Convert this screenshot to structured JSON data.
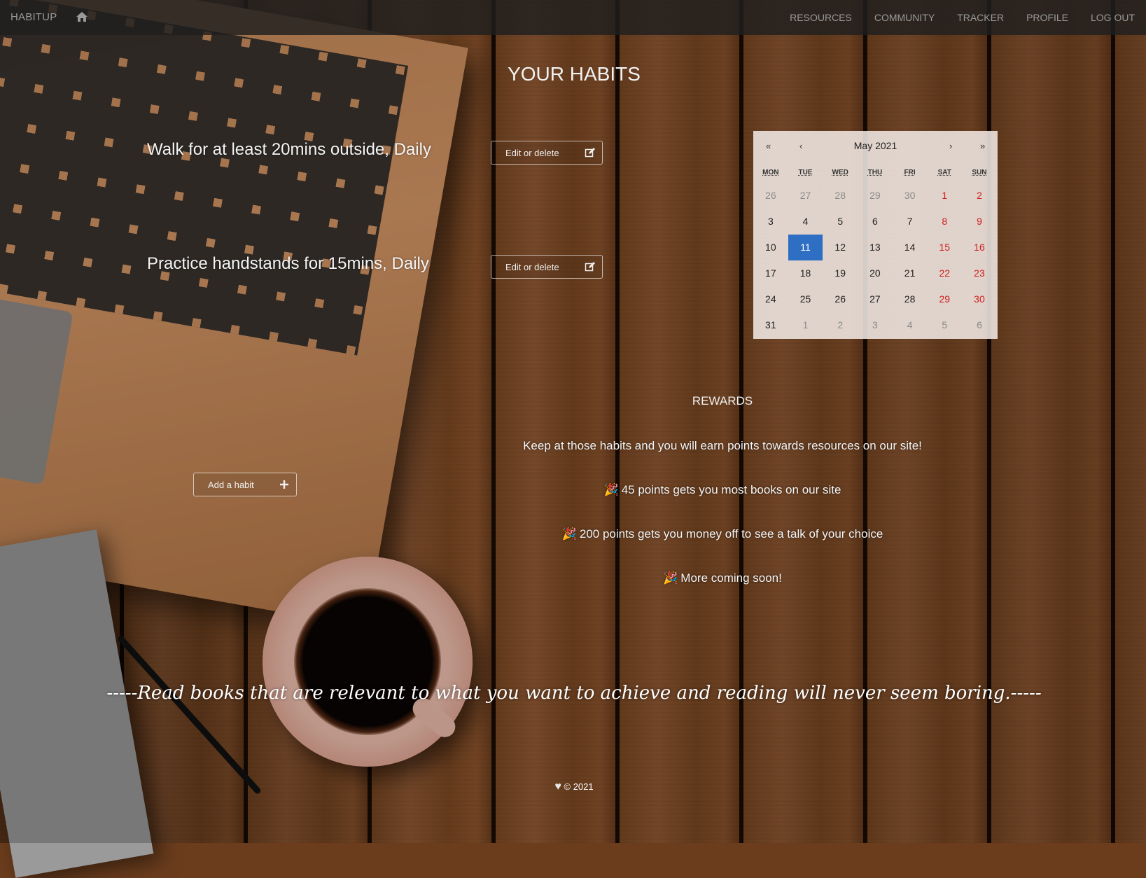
{
  "nav": {
    "brand": "HABITUP",
    "links": [
      "RESOURCES",
      "COMMUNITY",
      "TRACKER",
      "PROFILE",
      "LOG OUT"
    ]
  },
  "page": {
    "title": "YOUR HABITS"
  },
  "habits": [
    {
      "text": "Walk for at least 20mins outside, Daily",
      "button": "Edit or delete"
    },
    {
      "text": "Practice handstands for 15mins, Daily",
      "button": "Edit or delete"
    }
  ],
  "add_habit": {
    "label": "Add a habit"
  },
  "calendar": {
    "month": "May 2021",
    "nav": {
      "prev_year": "«",
      "prev_month": "‹",
      "next_month": "›",
      "next_year": "»"
    },
    "weekdays": [
      "MON",
      "TUE",
      "WED",
      "THU",
      "FRI",
      "SAT",
      "SUN"
    ],
    "weeks": [
      [
        "26",
        "27",
        "28",
        "29",
        "30",
        "1",
        "2"
      ],
      [
        "3",
        "4",
        "5",
        "6",
        "7",
        "8",
        "9"
      ],
      [
        "10",
        "11",
        "12",
        "13",
        "14",
        "15",
        "16"
      ],
      [
        "17",
        "18",
        "19",
        "20",
        "21",
        "22",
        "23"
      ],
      [
        "24",
        "25",
        "26",
        "27",
        "28",
        "29",
        "30"
      ],
      [
        "31",
        "1",
        "2",
        "3",
        "4",
        "5",
        "6"
      ]
    ],
    "selected": "11"
  },
  "rewards": {
    "title": "REWARDS",
    "intro": "Keep at those habits and you will earn points towards resources on our site!",
    "items": [
      "45 points gets you most books on our site",
      "200 points gets you money off to see a talk of your choice",
      "More coming soon!"
    ]
  },
  "quote": "-----Read books that are relevant to what you want to achieve and reading will never seem boring.-----",
  "footer": {
    "text": "© 2021"
  },
  "colors": {
    "accent": "#2e6fc4",
    "weekend": "#d01f1f",
    "navbar": "#1e1e1e"
  }
}
